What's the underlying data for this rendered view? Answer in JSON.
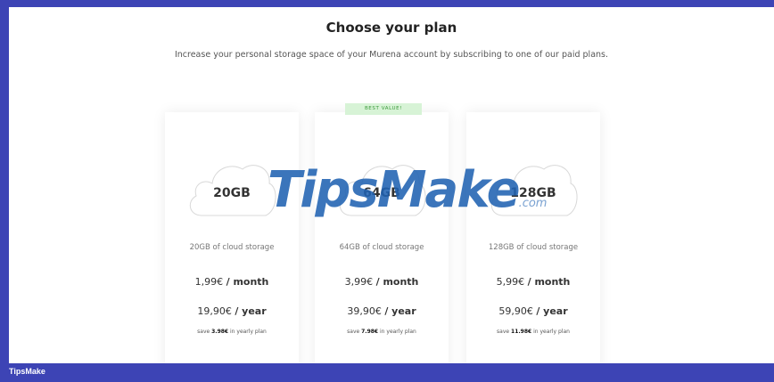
{
  "header": {
    "title": "Choose your plan",
    "subtitle": "Increase your personal storage space of your Murena account by subscribing to one of our paid plans."
  },
  "badge": "BEST VALUE!",
  "plans": [
    {
      "size": "20GB",
      "description": "20GB of cloud storage",
      "monthly_price": "1,99€",
      "monthly_unit": "/ month",
      "yearly_price": "19,90€",
      "yearly_unit": "/ year",
      "save_prefix": "save",
      "save_amount": "3.98€",
      "save_suffix": "in yearly plan"
    },
    {
      "size": "64GB",
      "description": "64GB of cloud storage",
      "monthly_price": "3,99€",
      "monthly_unit": "/ month",
      "yearly_price": "39,90€",
      "yearly_unit": "/ year",
      "save_prefix": "save",
      "save_amount": "7.98€",
      "save_suffix": "in yearly plan"
    },
    {
      "size": "128GB",
      "description": "128GB of cloud storage",
      "monthly_price": "5,99€",
      "monthly_unit": "/ month",
      "yearly_price": "59,90€",
      "yearly_unit": "/ year",
      "save_prefix": "save",
      "save_amount": "11.98€",
      "save_suffix": "in yearly plan"
    }
  ],
  "watermark": {
    "main": "TipsMake",
    "suffix": ".com"
  },
  "footer": {
    "label": "TipsMake"
  },
  "colors": {
    "frame": "#3d44b5",
    "badge_bg": "#d7f3d6",
    "badge_text": "#3a9a3a",
    "watermark": "#2062b2"
  },
  "icons": [
    "cloud-icon"
  ]
}
